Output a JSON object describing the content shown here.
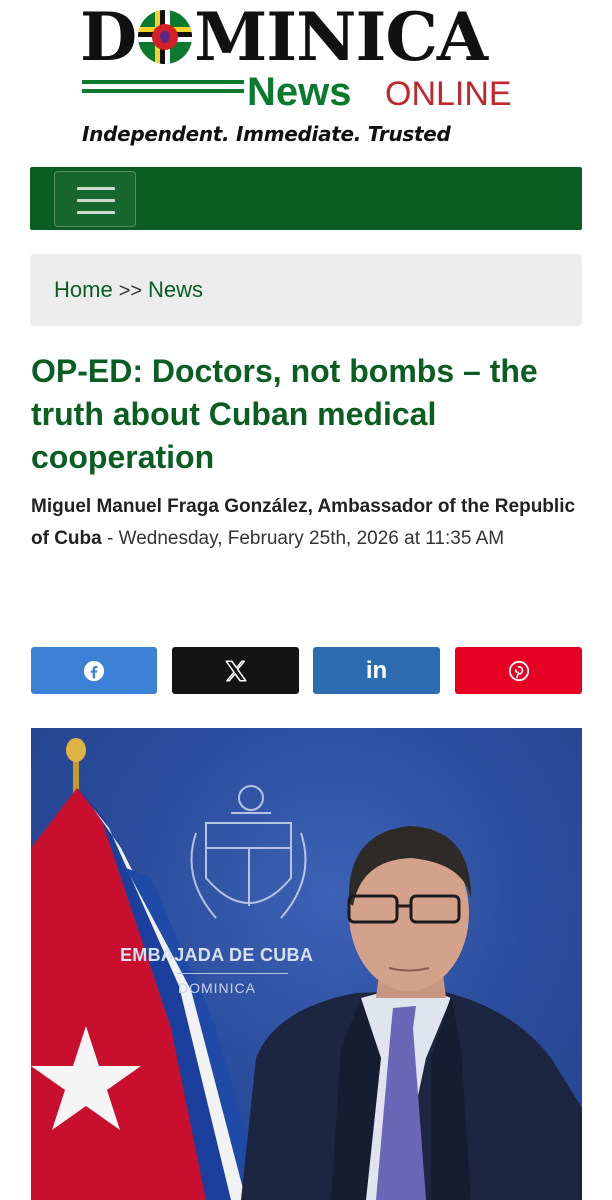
{
  "site": {
    "logo_prefix": "D",
    "logo_suffix": "MINICA",
    "logo_news": "News",
    "logo_online": "ONLINE",
    "tagline": "Independent. Immediate. Trusted",
    "brand_green": "#0b5e22",
    "brand_red": "#c0272d"
  },
  "nav": {
    "menu_icon": "hamburger-menu-icon"
  },
  "breadcrumb": {
    "home": "Home",
    "separator": ">>",
    "current": "News"
  },
  "article": {
    "title": "OP-ED: Doctors, not bombs – the truth about Cuban medical cooperation",
    "author": "Miguel Manuel Fraga González, Ambassador of the Republic of Cuba",
    "byline_separator": " - ",
    "date": "Wednesday, February 25th, 2026 at 11:35 AM"
  },
  "share": {
    "facebook_icon": "facebook-icon",
    "x_icon": "x-icon",
    "linkedin_label": "in",
    "pinterest_icon": "pinterest-icon",
    "colors": {
      "facebook": "#3b82d6",
      "x": "#141414",
      "linkedin": "#2b6db0",
      "pinterest": "#e60023"
    }
  },
  "photo": {
    "sign_title": "EMBAJADA DE CUBA",
    "sign_subtitle": "DOMINICA"
  }
}
